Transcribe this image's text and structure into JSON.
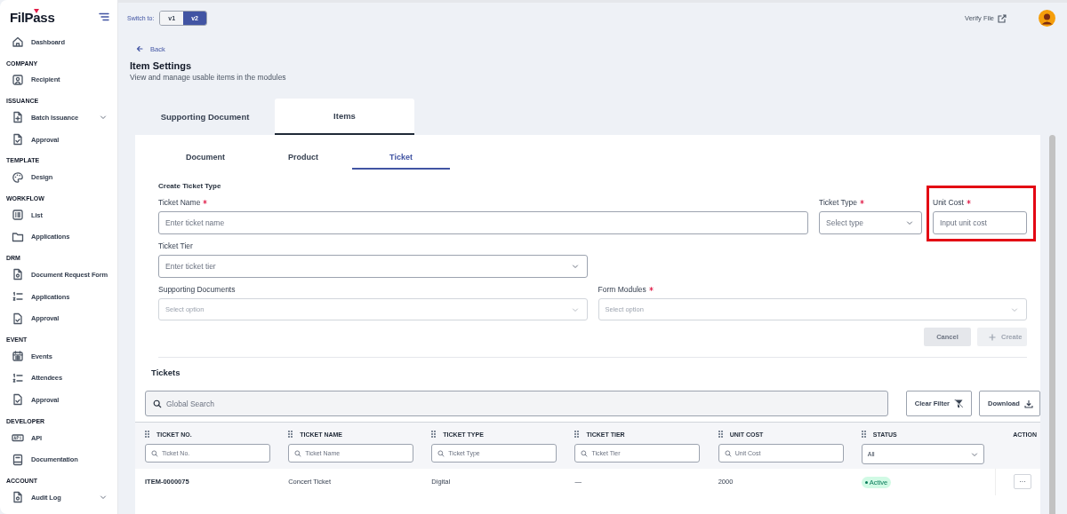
{
  "sidebar": {
    "logo": "FilPass",
    "items": [
      {
        "kind": "link",
        "label": "Dashboard"
      },
      {
        "kind": "section",
        "label": "COMPANY"
      },
      {
        "kind": "link",
        "label": "Recipient"
      },
      {
        "kind": "section",
        "label": "ISSUANCE"
      },
      {
        "kind": "group",
        "label": "Batch Issuance"
      },
      {
        "kind": "link",
        "label": "Approval"
      },
      {
        "kind": "section",
        "label": "TEMPLATE"
      },
      {
        "kind": "link",
        "label": "Design"
      },
      {
        "kind": "section",
        "label": "WORKFLOW"
      },
      {
        "kind": "link",
        "label": "List"
      },
      {
        "kind": "link",
        "label": "Applications"
      },
      {
        "kind": "section",
        "label": "DRM"
      },
      {
        "kind": "link",
        "label": "Document Request Form"
      },
      {
        "kind": "link",
        "label": "Applications"
      },
      {
        "kind": "link",
        "label": "Approval"
      },
      {
        "kind": "section",
        "label": "EVENT"
      },
      {
        "kind": "link",
        "label": "Events"
      },
      {
        "kind": "link",
        "label": "Attendees"
      },
      {
        "kind": "link",
        "label": "Approval"
      },
      {
        "kind": "section",
        "label": "DEVELOPER"
      },
      {
        "kind": "link",
        "label": "API"
      },
      {
        "kind": "link",
        "label": "Documentation"
      },
      {
        "kind": "section",
        "label": "ACCOUNT"
      },
      {
        "kind": "group",
        "label": "Audit Log"
      }
    ]
  },
  "topbar": {
    "switch_label": "Switch to:",
    "versions": [
      {
        "label": "v1",
        "selected": false
      },
      {
        "label": "v2",
        "selected": true
      }
    ],
    "verify_link": "Verify File"
  },
  "header": {
    "back": "Back",
    "title": "Item Settings",
    "subtitle": "View and manage usable items in the modules"
  },
  "tabs": [
    {
      "label": "Supporting Document",
      "selected": false
    },
    {
      "label": "Items",
      "selected": true
    }
  ],
  "subtabs": [
    {
      "label": "Document",
      "selected": false
    },
    {
      "label": "Product",
      "selected": false
    },
    {
      "label": "Ticket",
      "selected": true
    }
  ],
  "form": {
    "title": "Create Ticket Type",
    "rows": [
      {
        "fields": [
          {
            "kind": "input",
            "label": "Ticket Name",
            "required": true,
            "placeholder": "Enter ticket name",
            "highlighted": false
          },
          {
            "kind": "select",
            "label": "Ticket Type",
            "required": true,
            "placeholder": "Select type",
            "highlighted": false
          },
          {
            "kind": "input",
            "label": "Unit Cost",
            "required": true,
            "placeholder": "Input unit cost",
            "highlighted": true
          }
        ]
      },
      {
        "fields": [
          {
            "kind": "select",
            "label": "Ticket Tier",
            "required": false,
            "placeholder": "Enter ticket tier",
            "highlighted": false
          }
        ]
      },
      {
        "fields": [
          {
            "kind": "multiselect",
            "label": "Supporting Documents",
            "required": false,
            "placeholder": "Select option",
            "highlighted": false
          },
          {
            "kind": "multiselect",
            "label": "Form Modules",
            "required": true,
            "placeholder": "Select option",
            "highlighted": false
          }
        ]
      }
    ],
    "buttons": [
      {
        "kind": "cancel",
        "label": "Cancel",
        "disabled": true
      },
      {
        "kind": "create",
        "label": "Create",
        "disabled": true
      }
    ]
  },
  "tickets": {
    "title": "Tickets",
    "search": {
      "placeholder": "Global Search"
    },
    "clear_filter": "Clear Filter",
    "download": "Download",
    "columns": [
      {
        "label": "TICKET NO.",
        "filter": {
          "kind": "search",
          "placeholder": "Ticket No."
        }
      },
      {
        "label": "TICKET NAME",
        "filter": {
          "kind": "search",
          "placeholder": "Ticket Name"
        }
      },
      {
        "label": "TICKET TYPE",
        "filter": {
          "kind": "search",
          "placeholder": "Ticket Type"
        }
      },
      {
        "label": "TICKET TIER",
        "filter": {
          "kind": "search",
          "placeholder": "Ticket Tier"
        }
      },
      {
        "label": "UNIT COST",
        "filter": {
          "kind": "search",
          "placeholder": "Unit Cost"
        }
      },
      {
        "label": "STATUS",
        "filter": {
          "kind": "select",
          "value": "All"
        }
      },
      {
        "label": "ACTION"
      }
    ],
    "rows": [
      {
        "cells": [
          "ITEM-0000075",
          "Concert Ticket",
          "Digital",
          "—",
          "2000"
        ],
        "status": "Active",
        "action": "···"
      }
    ]
  }
}
